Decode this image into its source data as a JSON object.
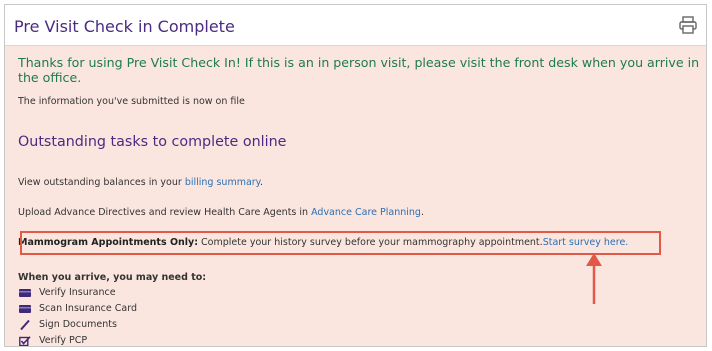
{
  "header": {
    "title": "Pre Visit Check in Complete",
    "print_icon": "printer-icon"
  },
  "messages": {
    "thanks": "Thanks for using Pre Visit Check In! If this is an in person visit, please visit the front desk when you arrive in the office.",
    "info": "The information you've submitted is now on file"
  },
  "tasks": {
    "heading": "Outstanding tasks to complete online",
    "balances_prefix": "View outstanding balances in your ",
    "balances_link": "billing summary",
    "balances_suffix": ".",
    "directives_prefix": "Upload Advance Directives and review Health Care Agents in ",
    "directives_link": "Advance Care Planning",
    "directives_suffix": ".",
    "mammo_bold": "Mammogram Appointments Only:",
    "mammo_text": " Complete your history survey before your mammography appointment.",
    "mammo_link": "Start survey here."
  },
  "arrival": {
    "title": "When you arrive, you may need to:",
    "items": [
      {
        "label": "Verify Insurance",
        "icon": "insurance-card-icon"
      },
      {
        "label": "Scan Insurance Card",
        "icon": "scan-card-icon"
      },
      {
        "label": "Sign Documents",
        "icon": "pen-icon"
      },
      {
        "label": "Verify PCP",
        "icon": "checkbox-edit-icon"
      }
    ]
  },
  "colors": {
    "background": "#fbe6df",
    "title_purple": "#4b2a82",
    "thanks_green": "#1f7a4c",
    "link_blue": "#2b6fb3",
    "annotation_red": "#e05a47"
  }
}
